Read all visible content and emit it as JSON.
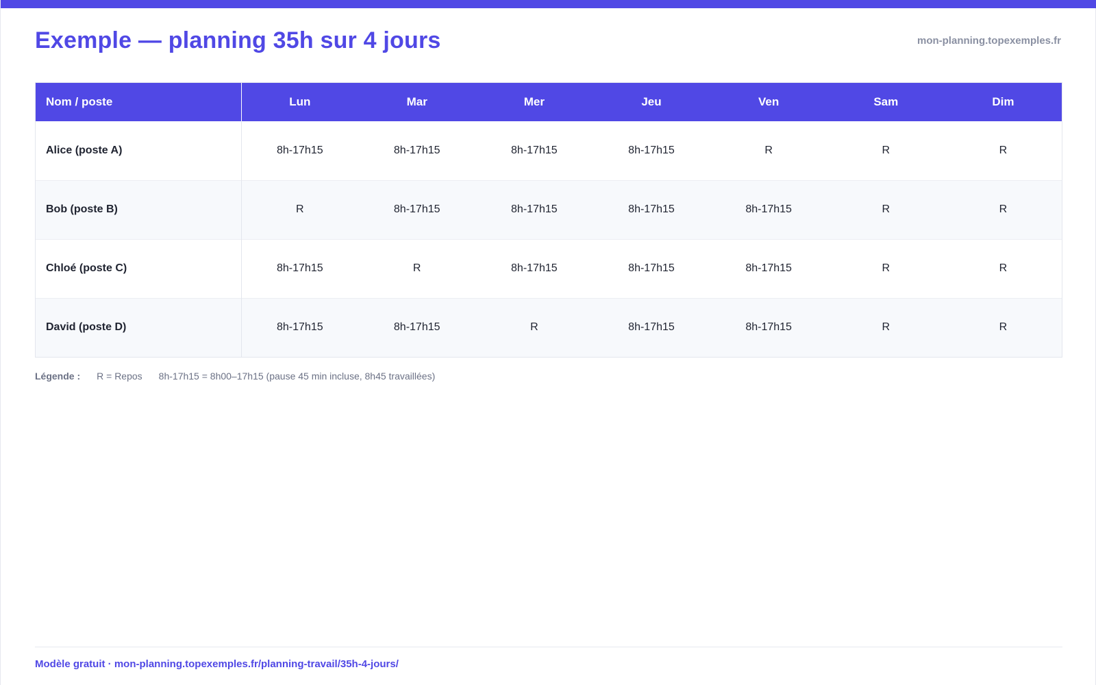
{
  "page": {
    "title": "Exemple — planning 35h sur 4 jours",
    "site": "mon-planning.topexemples.fr"
  },
  "table": {
    "name_header": "Nom / poste",
    "days": [
      "Lun",
      "Mar",
      "Mer",
      "Jeu",
      "Ven",
      "Sam",
      "Dim"
    ],
    "rows": [
      {
        "name": "Alice (poste A)",
        "cells": [
          "8h-17h15",
          "8h-17h15",
          "8h-17h15",
          "8h-17h15",
          "R",
          "R",
          "R"
        ]
      },
      {
        "name": "Bob (poste B)",
        "cells": [
          "R",
          "8h-17h15",
          "8h-17h15",
          "8h-17h15",
          "8h-17h15",
          "R",
          "R"
        ]
      },
      {
        "name": "Chloé (poste C)",
        "cells": [
          "8h-17h15",
          "R",
          "8h-17h15",
          "8h-17h15",
          "8h-17h15",
          "R",
          "R"
        ]
      },
      {
        "name": "David (poste D)",
        "cells": [
          "8h-17h15",
          "8h-17h15",
          "R",
          "8h-17h15",
          "8h-17h15",
          "R",
          "R"
        ]
      }
    ]
  },
  "legend": {
    "label": "Légende :",
    "items": [
      "R = Repos",
      "8h-17h15 = 8h00–17h15 (pause 45 min incluse, 8h45 travaillées)"
    ]
  },
  "footer": {
    "text": "Modèle gratuit · mon-planning.topexemples.fr/planning-travail/35h-4-jours/"
  },
  "colors": {
    "accent": "#5048e5",
    "row_alt": "#f7f9fc",
    "muted": "#8a90a2"
  }
}
